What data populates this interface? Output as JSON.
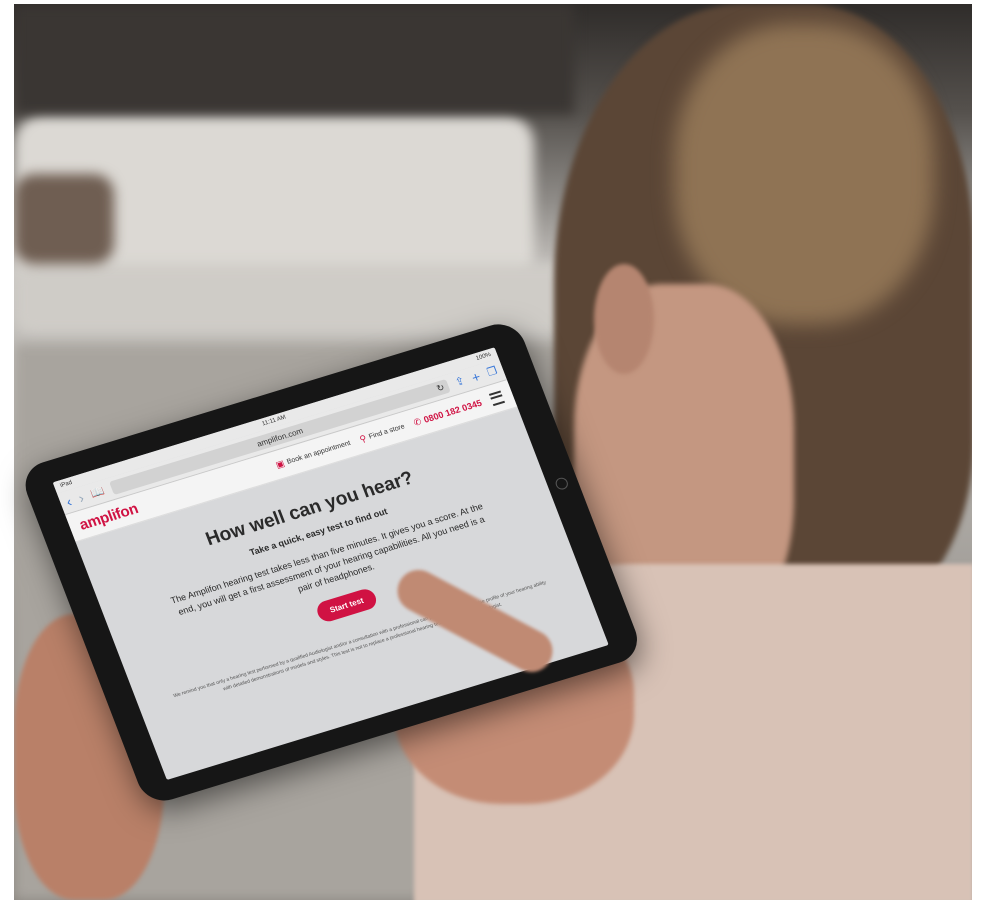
{
  "status_bar": {
    "device": "iPad",
    "time": "11:11 AM",
    "battery": "100%"
  },
  "browser": {
    "url": "amplifon.com"
  },
  "site": {
    "logo": "amplifon",
    "nav": {
      "book": "Book an appointment",
      "store": "Find a store",
      "phone": "0800 182 0345"
    }
  },
  "content": {
    "heading": "How well can you hear?",
    "subheading": "Take a quick, easy test to find out",
    "intro": "The Amplifon hearing test takes less than five minutes. It gives you a score. At the end, you will get a first assessment of your hearing capabilities. All you need is a pair of headphones.",
    "start_button": "Start test",
    "disclaimer": "We remind you that only a hearing test performed by a qualified Audiologist and/or a consultation with a professional can provide you with a precise profile of your hearing ability with detailed demonstrations of models and styles. This test is not to replace a professional hearing test from a qualified Audiologist."
  },
  "colors": {
    "brand": "#d01243",
    "link": "#3a78d8"
  }
}
